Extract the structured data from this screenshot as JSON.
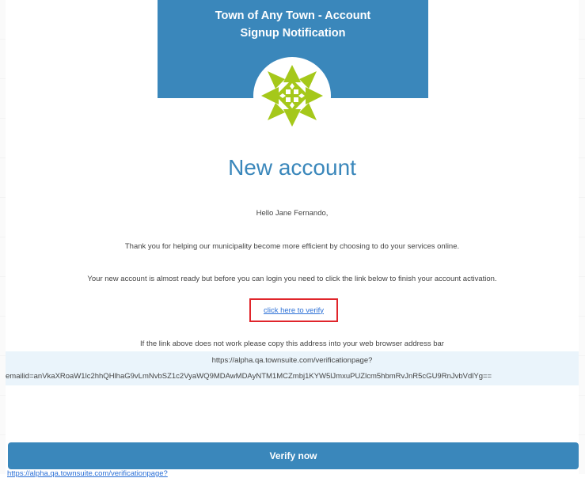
{
  "header": {
    "title_line1": "Town of Any Town - Account",
    "title_line2": "Signup Notification"
  },
  "logo": {
    "icon": "geometric-star-logo",
    "color": "#a5c81a"
  },
  "main": {
    "heading": "New account",
    "greeting": "Hello Jane Fernando,",
    "thanks": "Thank you for helping our municipality become more efficient by choosing to do your services online.",
    "instruction": "Your new account is almost ready but before you can login you need to click the link below to finish your account activation.",
    "verify_link": "click here to verify",
    "fallback_note": "If the link above does not work please copy this address into your web browser address bar",
    "url_line1": "https://alpha.qa.townsuite.com/verificationpage?",
    "url_line2": "emailid=anVkaXRoaW1lc2hhQHlhaG9vLmNvbSZ1c2VyaWQ9MDAwMDAyNTM1MCZmbj1KYW5lJmxuPUZlcm5hbmRvJnR5cGU9RnJvbVdlYg=="
  },
  "footer": {
    "verify_button": "Verify now",
    "bottom_link": "https://alpha.qa.townsuite.com/verificationpage?"
  },
  "colors": {
    "brand_blue": "#3a87bb",
    "highlight_red": "#e0252b",
    "link_blue": "#2a6fd6"
  }
}
